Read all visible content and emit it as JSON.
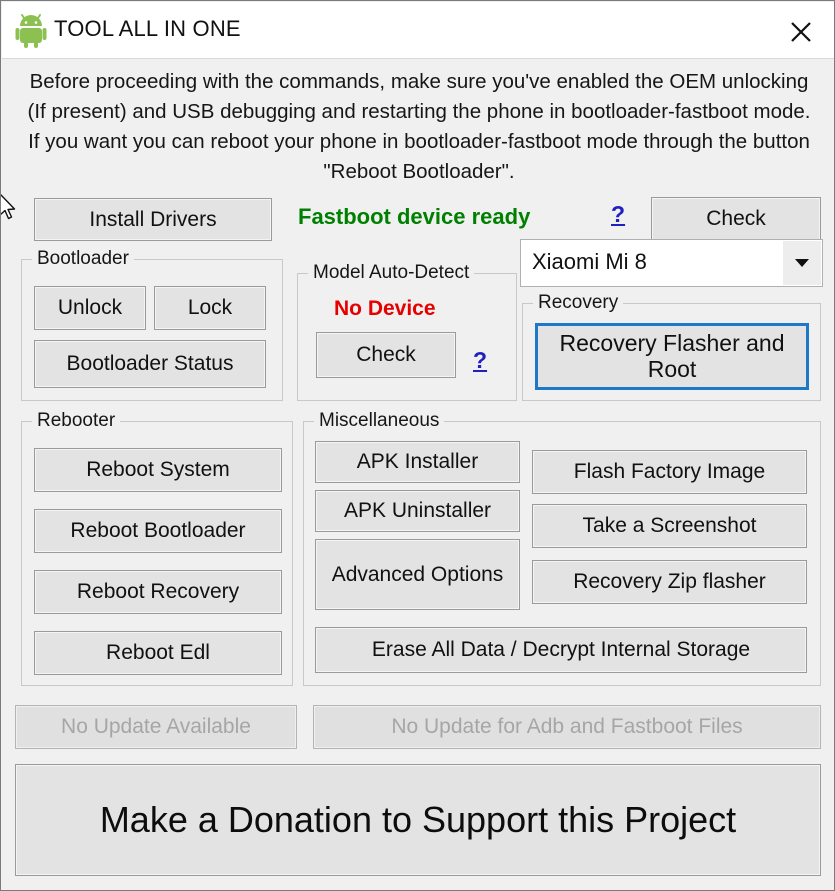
{
  "window": {
    "title": "TOOL ALL IN ONE",
    "app_icon": "android-robot-icon",
    "close_icon": "close-icon",
    "accent_green": "#008000",
    "accent_red": "#e60000",
    "link_blue": "#2020c0",
    "focus_blue": "#1e78c8",
    "background": "#f0f0f0"
  },
  "instructions": "Before proceeding with the commands, make sure you've enabled the OEM unlocking (If present) and USB debugging and restarting the phone in bootloader-fastboot mode. If you want you can reboot your phone in bootloader-fastboot mode through the button \"Reboot Bootloader\".",
  "top_row": {
    "install_drivers": "Install Drivers",
    "fastboot_status": "Fastboot device ready",
    "help": "?",
    "check": "Check"
  },
  "device_select": {
    "value": "Xiaomi Mi 8",
    "arrow_icon": "chevron-down-icon"
  },
  "bootloader": {
    "legend": "Bootloader",
    "unlock": "Unlock",
    "lock": "Lock",
    "status": "Bootloader Status"
  },
  "model_auto_detect": {
    "legend": "Model Auto-Detect",
    "state": "No Device",
    "check": "Check",
    "help": "?"
  },
  "recovery": {
    "legend": "Recovery",
    "flasher_root": "Recovery Flasher and Root"
  },
  "rebooter": {
    "legend": "Rebooter",
    "items": [
      "Reboot System",
      "Reboot Bootloader",
      "Reboot Recovery",
      "Reboot Edl"
    ]
  },
  "miscellaneous": {
    "legend": "Miscellaneous",
    "apk_installer": "APK Installer",
    "apk_uninstaller": "APK Uninstaller",
    "advanced_options": "Advanced Options",
    "flash_factory_image": "Flash Factory Image",
    "take_screenshot": "Take a Screenshot",
    "recovery_zip_flasher": "Recovery Zip flasher",
    "erase_all_data": "Erase All Data / Decrypt Internal Storage"
  },
  "updates": {
    "app_update": "No Update Available",
    "files_update": "No Update for Adb and Fastboot Files"
  },
  "donation": "Make a Donation to Support this Project"
}
